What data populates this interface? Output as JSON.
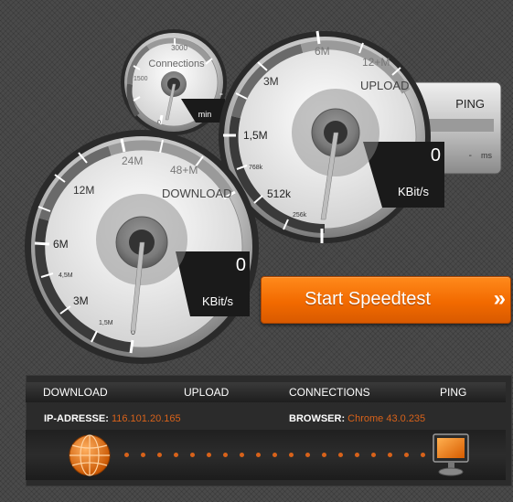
{
  "connections_gauge": {
    "label": "Connections",
    "ticks": [
      "0",
      "1500",
      "3000"
    ],
    "value": "-",
    "unit": "min"
  },
  "upload_gauge": {
    "label": "UPLOAD",
    "ticks": [
      "256k",
      "512k",
      "768k",
      "1,5M",
      "3M",
      "6M",
      "12+M"
    ],
    "value": "0",
    "unit": "KBit/s"
  },
  "download_gauge": {
    "label": "DOWNLOAD",
    "ticks": [
      "0",
      "1,5M",
      "3M",
      "4,5M",
      "6M",
      "12M",
      "24M",
      "48+M"
    ],
    "value": "0",
    "unit": "KBit/s"
  },
  "ping": {
    "label": "PING",
    "value": "-",
    "unit": "ms"
  },
  "start_button": {
    "label": "Start Speedtest",
    "arrow": "»"
  },
  "results": {
    "headers": [
      "DOWNLOAD",
      "UPLOAD",
      "CONNECTIONS",
      "PING"
    ],
    "ip_label": "IP-ADRESSE:",
    "ip_value": "116.101.20.165",
    "browser_label": "BROWSER:",
    "browser_value": "Chrome 43.0.235"
  },
  "colors": {
    "accent": "#f26a00",
    "background": "#4a4a4a",
    "info_value": "#d8621a"
  },
  "icons": [
    "globe-icon",
    "monitor-icon",
    "double-chevron-right-icon"
  ]
}
